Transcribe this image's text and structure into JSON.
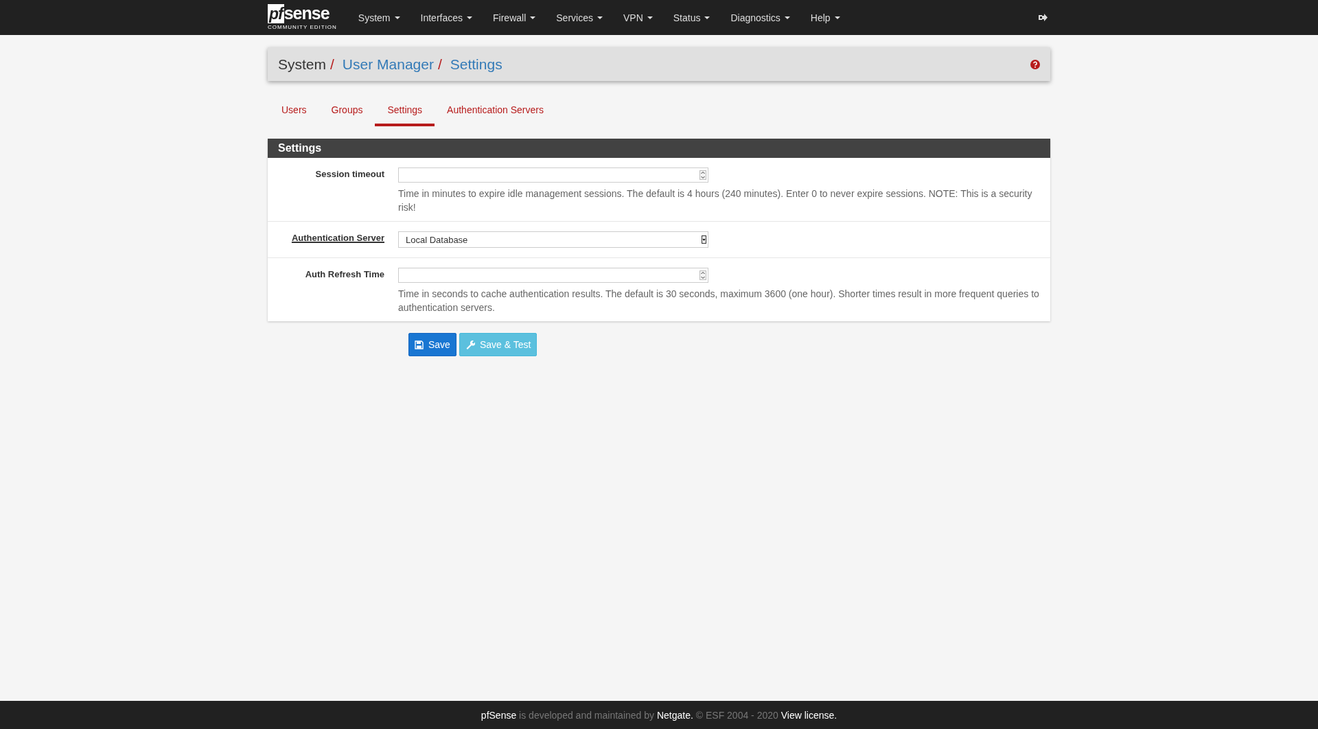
{
  "navbar": {
    "logo": {
      "mark": "pf",
      "word": "sense",
      "edition": "COMMUNITY EDITION"
    },
    "menus": [
      {
        "label": "System"
      },
      {
        "label": "Interfaces"
      },
      {
        "label": "Firewall"
      },
      {
        "label": "Services"
      },
      {
        "label": "VPN"
      },
      {
        "label": "Status"
      },
      {
        "label": "Diagnostics"
      },
      {
        "label": "Help"
      }
    ]
  },
  "breadcrumb_separator": "/",
  "breadcrumb": [
    {
      "label": "System",
      "kind": "text"
    },
    {
      "label": "User Manager",
      "kind": "link"
    },
    {
      "label": "Settings",
      "kind": "link"
    }
  ],
  "tabs": [
    {
      "label": "Users",
      "selected": false
    },
    {
      "label": "Groups",
      "selected": false
    },
    {
      "label": "Settings",
      "selected": true
    },
    {
      "label": "Authentication Servers",
      "selected": false
    }
  ],
  "panel": {
    "title": "Settings",
    "rows": [
      {
        "label": "Session timeout",
        "has_help": false,
        "kind": "number",
        "value": "",
        "help": "Time in minutes to expire idle management sessions. The default is 4 hours (240 minutes). Enter 0 to never expire sessions. NOTE: This is a security risk!"
      },
      {
        "label": "Authentication Server",
        "has_help": true,
        "kind": "select",
        "value": "Local Database"
      },
      {
        "label": "Auth Refresh Time",
        "has_help": false,
        "kind": "number",
        "value": "",
        "help": "Time in seconds to cache authentication results. The default is 30 seconds, maximum 3600 (one hour). Shorter times result in more frequent queries to authentication servers."
      }
    ]
  },
  "buttons": [
    {
      "label": "Save",
      "kind": "save"
    },
    {
      "label": "Save & Test",
      "kind": "test"
    }
  ],
  "footer": [
    {
      "text": "pfSense",
      "kind": "brand"
    },
    {
      "text": "is developed and maintained by",
      "kind": "text"
    },
    {
      "text": "Netgate.",
      "kind": "link"
    },
    {
      "text": "© ESF 2004 - 2020",
      "kind": "text"
    },
    {
      "text": "View license.",
      "kind": "link"
    }
  ]
}
